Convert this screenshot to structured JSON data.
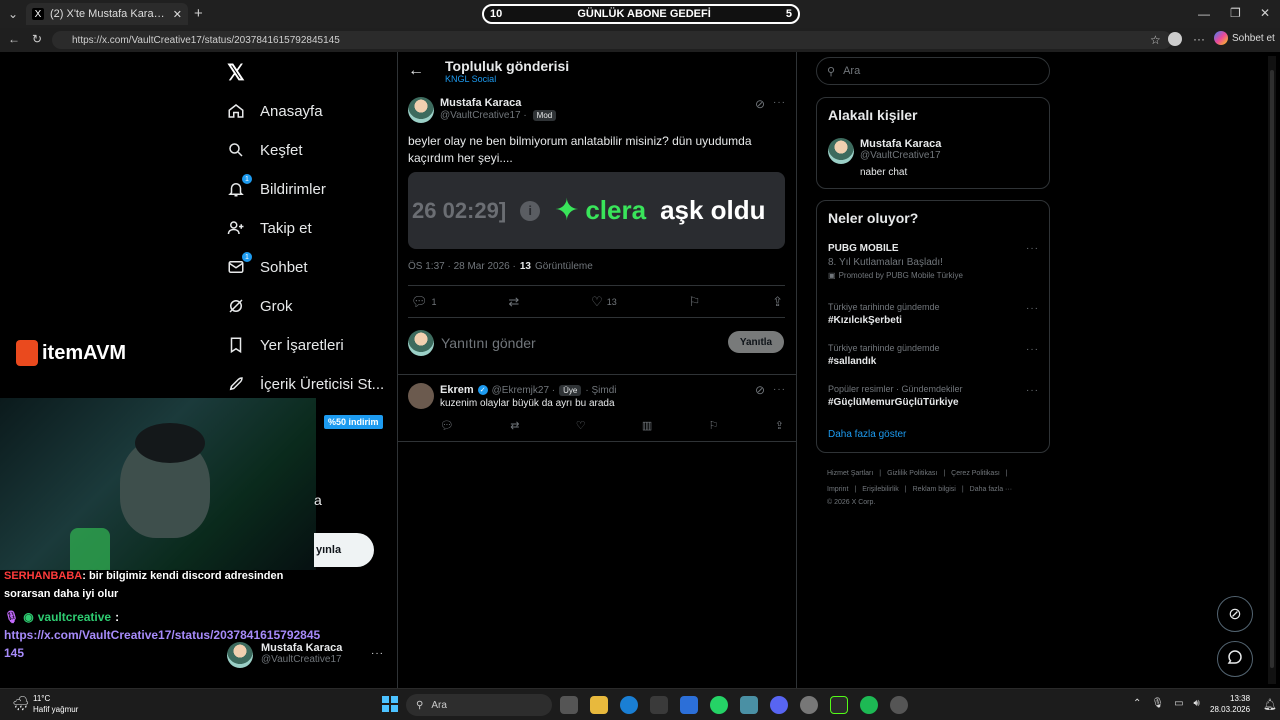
{
  "browser": {
    "tab_title": "(2) X'te Mustafa Karaca: \"beyler ol",
    "tab_icon": "X",
    "new_tab": "+",
    "url": "https://x.com/VaultCreative17/status/2037841615792845145",
    "copilot_label": "Sohbet et"
  },
  "stream_banner": {
    "left": "10",
    "title": "GÜNLÜK ABONE GEDEFİ",
    "right": "5"
  },
  "sidebar": {
    "items": [
      {
        "label": "Anasayfa",
        "icon": "home-icon"
      },
      {
        "label": "Keşfet",
        "icon": "search-icon"
      },
      {
        "label": "Bildirimler",
        "icon": "bell-icon",
        "badge": "1"
      },
      {
        "label": "Takip et",
        "icon": "follow-icon"
      },
      {
        "label": "Sohbet",
        "icon": "mail-icon",
        "badge": "1"
      },
      {
        "label": "Grok",
        "icon": "grok-icon"
      },
      {
        "label": "Yer İşaretleri",
        "icon": "bookmark-icon"
      },
      {
        "label": "İçerik Üreticisi St...",
        "icon": "rocket-icon"
      }
    ],
    "profile": {
      "name": "Mustafa Karaca",
      "handle": "@VaultCreative17"
    },
    "more": "···"
  },
  "sponsor": {
    "logo_text": "itemAVM",
    "discount": "%50 indirim"
  },
  "post_page": {
    "header_title": "Topluluk gönderisi",
    "header_sub": "KNGL Social",
    "post": {
      "author": "Mustafa Karaca",
      "handle": "@VaultCreative17 ·",
      "role": "Mod",
      "text_line1": "beyler olay ne ben bilmiyorum anlatabilir misiniz? dün uyudumda",
      "text_line2": "kaçırdım her şeyi....",
      "image_text_left": "26 02:29]",
      "image_text_brand": "clera",
      "image_text_right": "aşk oldu",
      "meta_time": "ÖS 1:37 · 28 Mar 2026 ·",
      "views_count": "13",
      "views_label": "Görüntüleme",
      "replies": "1",
      "likes": "13"
    },
    "reply_box": {
      "placeholder": "Yanıtını gönder",
      "button": "Yanıtla"
    },
    "reply": {
      "author": "Ekrem",
      "handle": "@Ekremjk27 ·",
      "role": "Üye",
      "time": "· Şimdi",
      "text": "kuzenim olaylar büyük da ayrı bu arada"
    }
  },
  "right": {
    "search_placeholder": "Ara",
    "related": {
      "title": "Alakalı kişiler",
      "name": "Mustafa Karaca",
      "handle": "@VaultCreative17",
      "bio": "naber chat"
    },
    "trends": {
      "title": "Neler oluyor?",
      "items": [
        {
          "small": "",
          "big": "PUBG MOBILE",
          "sub": "8. Yıl Kutlamaları Başladı!",
          "promo": "Promoted by PUBG Mobile Türkiye"
        },
        {
          "small": "Türkiye tarihinde gündemde",
          "big": "#KızılcıkŞerbeti"
        },
        {
          "small": "Türkiye tarihinde gündemde",
          "big": "#sallandık"
        },
        {
          "small": "Popüler resimler · Gündemdekiler",
          "big": "#GüçlüMemurGüçlüTürkiye"
        }
      ],
      "more": "Daha fazla göster"
    },
    "footer": {
      "l1": [
        "Hizmet Şartları",
        "Gizlilik Politikası",
        "Çerez Politikası"
      ],
      "l2": [
        "Imprint",
        "Erişilebilirlik",
        "Reklam bilgisi",
        "Daha fazla ···"
      ],
      "copyright": "© 2026 X Corp."
    }
  },
  "stream_chat": {
    "line1_user": "SERHANBABA",
    "line1_text": ": bir bilgimiz kendi discord adresinden",
    "line2_text": "sorarsan daha iyi olur",
    "line3_user": "vaultcreative",
    "line3_colon": ":",
    "link": "https://x.com/VaultCreative17/status/2037841615792845",
    "link2": "145",
    "partial_post": "yınla",
    "partial_a": "a"
  },
  "taskbar": {
    "temp": "11°C",
    "weather": "Hafif yağmur",
    "search": "Ara",
    "time": "13:38",
    "date": "28.03.2026"
  }
}
